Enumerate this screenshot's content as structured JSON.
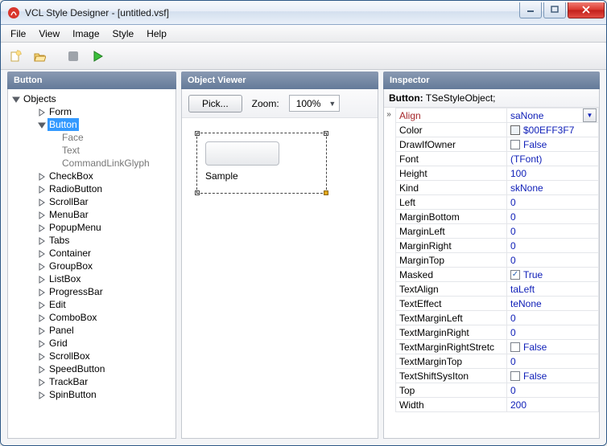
{
  "window": {
    "title": "VCL Style Designer - [untitled.vsf]"
  },
  "menu": {
    "items": [
      "File",
      "View",
      "Image",
      "Style",
      "Help"
    ]
  },
  "panels": {
    "left_title": "Button",
    "mid_title": "Object Viewer",
    "right_title": "Inspector"
  },
  "tree": {
    "root": "Objects",
    "items": [
      {
        "label": "Form",
        "depth": 1,
        "exp": "closed"
      },
      {
        "label": "Button",
        "depth": 1,
        "exp": "open",
        "selected": true
      },
      {
        "label": "Face",
        "depth": 2,
        "exp": "none",
        "muted": true
      },
      {
        "label": "Text",
        "depth": 2,
        "exp": "none",
        "muted": true
      },
      {
        "label": "CommandLinkGlyph",
        "depth": 2,
        "exp": "none",
        "muted": true
      },
      {
        "label": "CheckBox",
        "depth": 1,
        "exp": "closed"
      },
      {
        "label": "RadioButton",
        "depth": 1,
        "exp": "closed"
      },
      {
        "label": "ScrollBar",
        "depth": 1,
        "exp": "closed"
      },
      {
        "label": "MenuBar",
        "depth": 1,
        "exp": "closed"
      },
      {
        "label": "PopupMenu",
        "depth": 1,
        "exp": "closed"
      },
      {
        "label": "Tabs",
        "depth": 1,
        "exp": "closed"
      },
      {
        "label": "Container",
        "depth": 1,
        "exp": "closed"
      },
      {
        "label": "GroupBox",
        "depth": 1,
        "exp": "closed"
      },
      {
        "label": "ListBox",
        "depth": 1,
        "exp": "closed"
      },
      {
        "label": "ProgressBar",
        "depth": 1,
        "exp": "closed"
      },
      {
        "label": "Edit",
        "depth": 1,
        "exp": "closed"
      },
      {
        "label": "ComboBox",
        "depth": 1,
        "exp": "closed"
      },
      {
        "label": "Panel",
        "depth": 1,
        "exp": "closed"
      },
      {
        "label": "Grid",
        "depth": 1,
        "exp": "closed"
      },
      {
        "label": "ScrollBox",
        "depth": 1,
        "exp": "closed"
      },
      {
        "label": "SpeedButton",
        "depth": 1,
        "exp": "closed"
      },
      {
        "label": "TrackBar",
        "depth": 1,
        "exp": "closed"
      },
      {
        "label": "SpinButton",
        "depth": 1,
        "exp": "closed",
        "cut": true
      }
    ]
  },
  "viewer": {
    "pick_label": "Pick...",
    "zoom_label": "Zoom:",
    "zoom_value": "100%",
    "sample_label": "Sample"
  },
  "inspector": {
    "header_name": "Button:",
    "header_type": "TSeStyleObject;",
    "rows": [
      {
        "name": "Align",
        "value": "saNone",
        "active": true,
        "dropdown": true,
        "marker": true
      },
      {
        "name": "Color",
        "value": "$00EFF3F7",
        "swatch": "#eff3f7"
      },
      {
        "name": "DrawIfOwner",
        "value": "False",
        "check": false
      },
      {
        "name": "Font",
        "value": "(TFont)",
        "expand": true
      },
      {
        "name": "Height",
        "value": "100"
      },
      {
        "name": "Kind",
        "value": "skNone"
      },
      {
        "name": "Left",
        "value": "0"
      },
      {
        "name": "MarginBottom",
        "value": "0"
      },
      {
        "name": "MarginLeft",
        "value": "0"
      },
      {
        "name": "MarginRight",
        "value": "0"
      },
      {
        "name": "MarginTop",
        "value": "0"
      },
      {
        "name": "Masked",
        "value": "True",
        "check": true
      },
      {
        "name": "TextAlign",
        "value": "taLeft"
      },
      {
        "name": "TextEffect",
        "value": "teNone"
      },
      {
        "name": "TextMarginLeft",
        "value": "0"
      },
      {
        "name": "TextMarginRight",
        "value": "0"
      },
      {
        "name": "TextMarginRightStretch",
        "value": "False",
        "check": false,
        "truncated": "TextMarginRightStretc"
      },
      {
        "name": "TextMarginTop",
        "value": "0"
      },
      {
        "name": "TextShiftSysIton",
        "value": "False",
        "check": false
      },
      {
        "name": "Top",
        "value": "0"
      },
      {
        "name": "Width",
        "value": "200"
      }
    ]
  }
}
